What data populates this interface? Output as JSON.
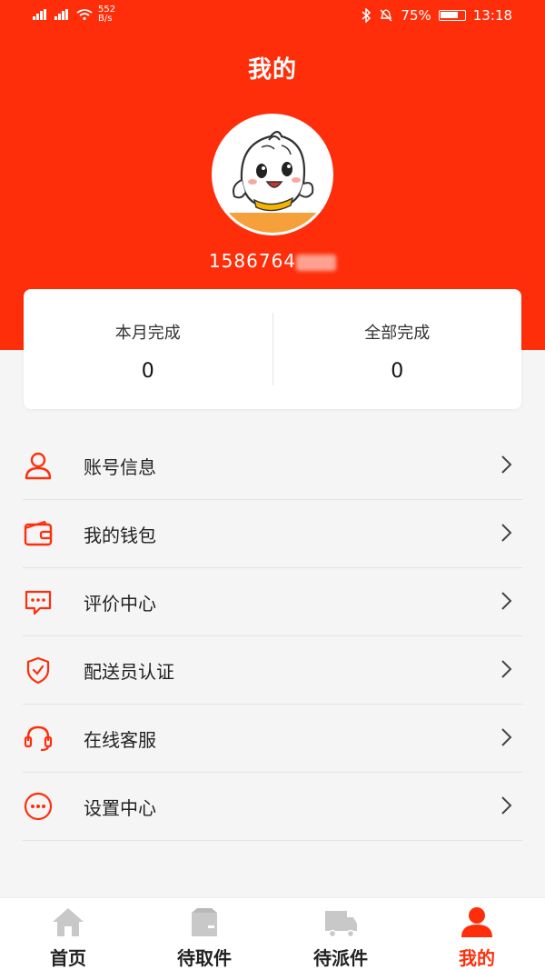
{
  "status_bar": {
    "left_icons": "signal-icons",
    "speed_value": "552",
    "speed_unit": "B/s",
    "battery_percent": "75%",
    "time": "13:18"
  },
  "header": {
    "title": "我的",
    "avatar_icon": "mascot-avatar",
    "phone_visible": "1586764"
  },
  "stats": {
    "month": {
      "label": "本月完成",
      "value": "0"
    },
    "all": {
      "label": "全部完成",
      "value": "0"
    }
  },
  "menu": {
    "items": [
      {
        "label": "账号信息",
        "icon": "user-icon"
      },
      {
        "label": "我的钱包",
        "icon": "wallet-icon"
      },
      {
        "label": "评价中心",
        "icon": "comment-icon"
      },
      {
        "label": "配送员认证",
        "icon": "shield-icon"
      },
      {
        "label": "在线客服",
        "icon": "headset-icon"
      },
      {
        "label": "设置中心",
        "icon": "more-icon"
      }
    ]
  },
  "tabbar": {
    "tabs": [
      {
        "label": "首页",
        "icon": "home-icon",
        "active": false
      },
      {
        "label": "待取件",
        "icon": "package-icon",
        "active": false
      },
      {
        "label": "待派件",
        "icon": "truck-icon",
        "active": false
      },
      {
        "label": "我的",
        "icon": "person-icon",
        "active": true
      }
    ]
  },
  "colors": {
    "accent": "#ff2e0a",
    "inactive_icon": "#c8c8c8"
  }
}
